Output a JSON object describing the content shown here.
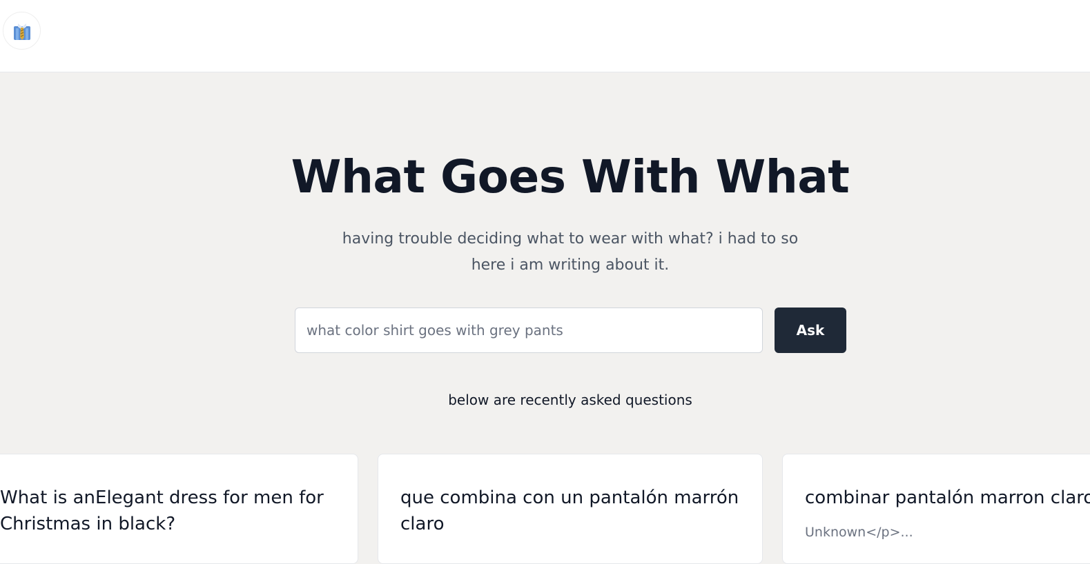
{
  "header": {
    "logo_icon": "necktie-shirt-icon"
  },
  "hero": {
    "title": "What Goes With What",
    "subtitle": "having trouble deciding what to wear with what? i had to so here i am writing about it."
  },
  "search": {
    "placeholder": "what color shirt goes with grey pants",
    "value": "",
    "button_label": "Ask"
  },
  "recent": {
    "label": "below are recently asked questions",
    "questions": [
      {
        "title": "What is anElegant dress for men for Christmas in black?",
        "excerpt": ""
      },
      {
        "title": "que combina con un pantalón marrón claro",
        "excerpt": ""
      },
      {
        "title": "combinar pantalón marron claro",
        "excerpt": "Unknown</p>..."
      }
    ]
  },
  "colors": {
    "page_bg": "#f2f1ef",
    "button_bg": "#1f2937",
    "title_text": "#111827",
    "muted_text": "#6b7280"
  }
}
